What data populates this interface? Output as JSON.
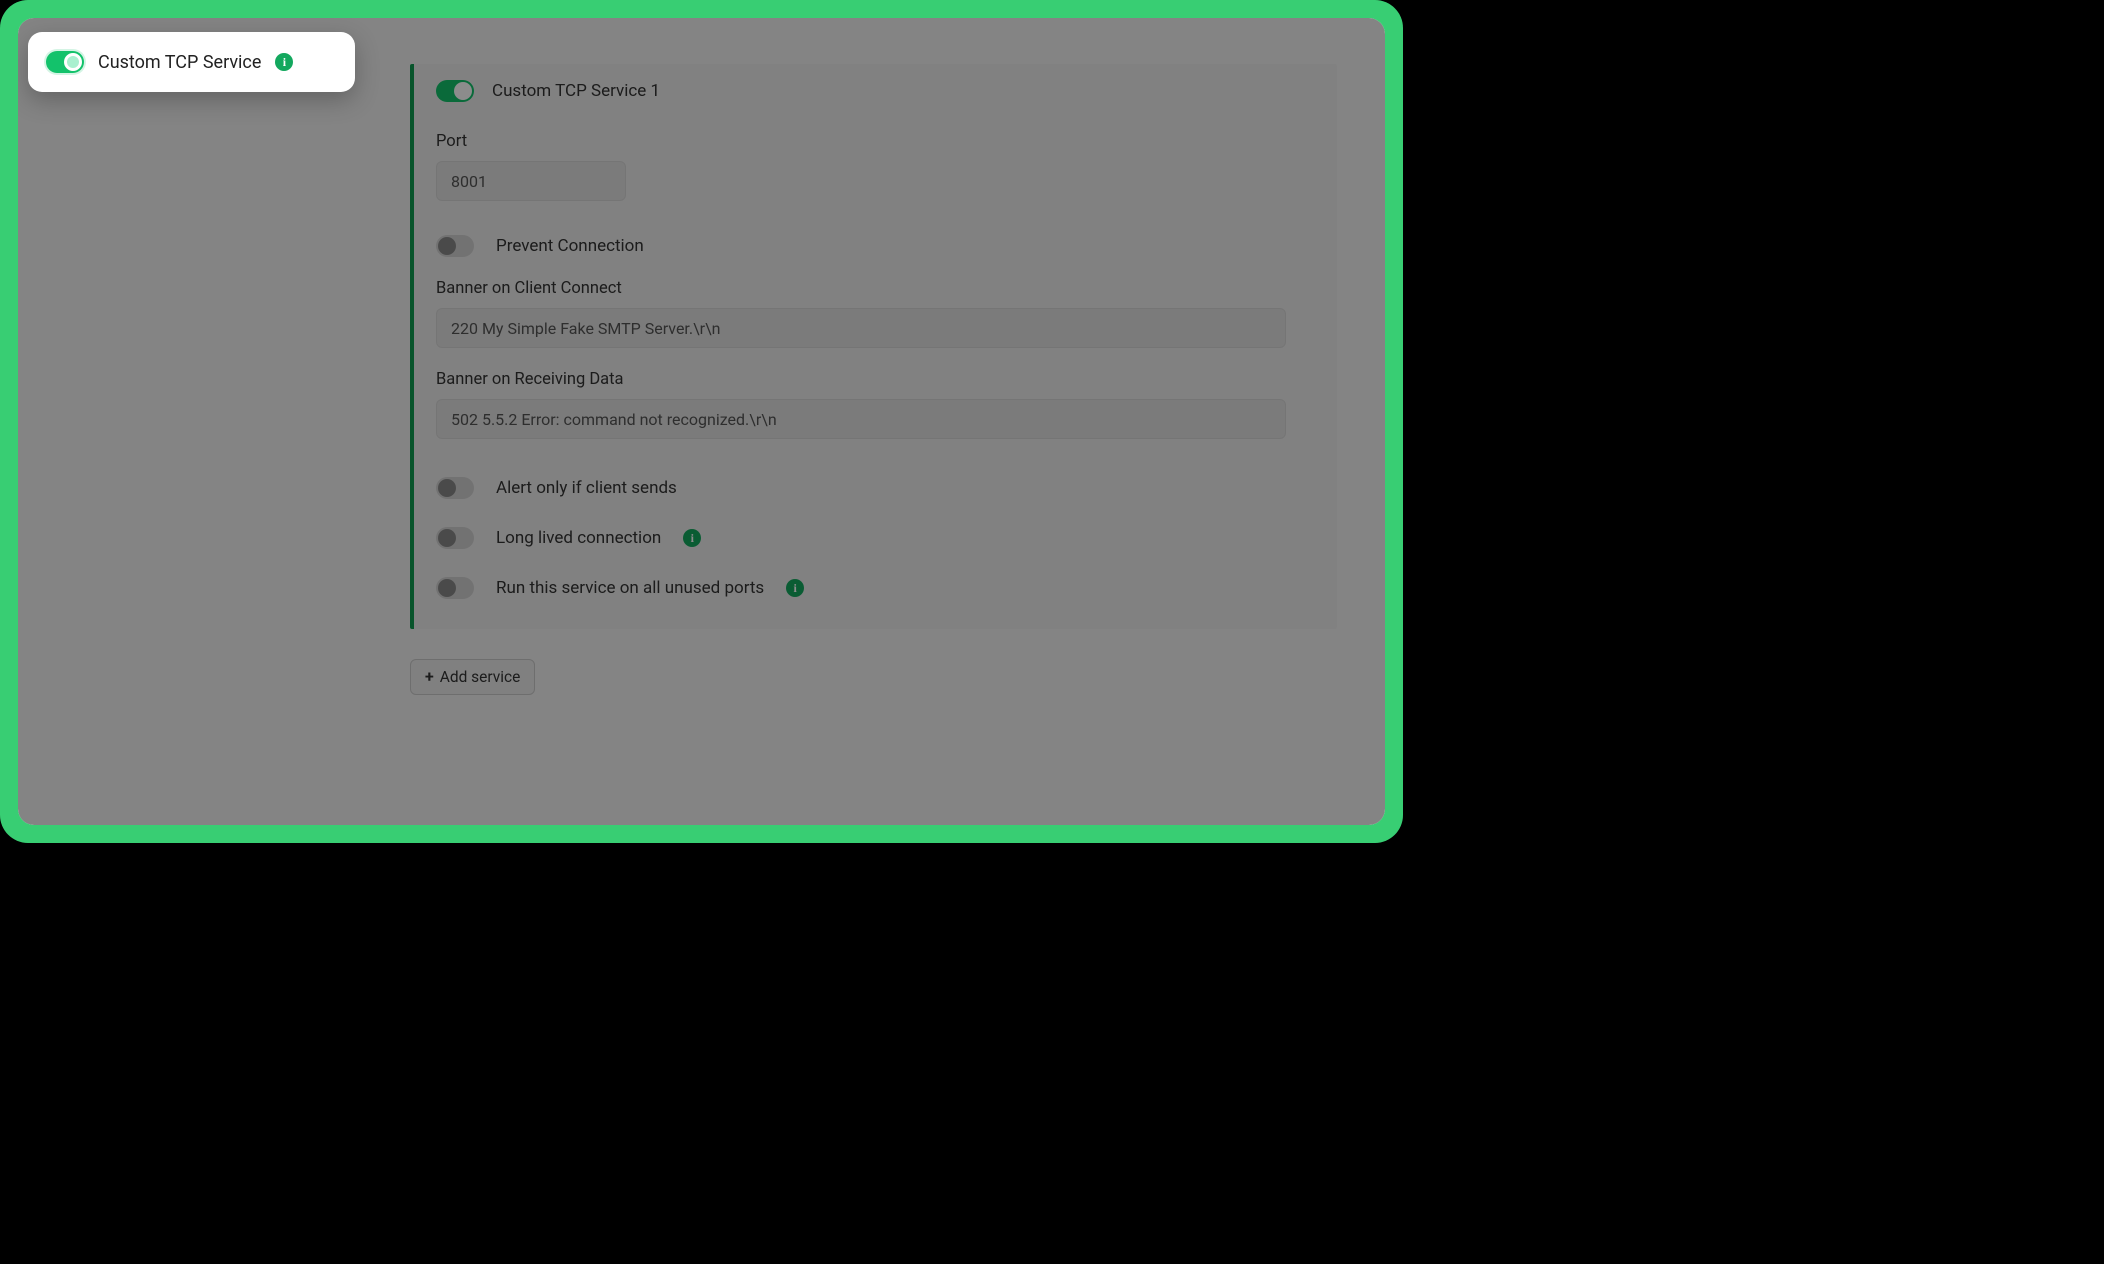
{
  "highlight": {
    "label": "Custom TCP Service",
    "enabled": true
  },
  "service": {
    "header_label": "Custom TCP Service 1",
    "header_enabled": true,
    "port": {
      "label": "Port",
      "value": "8001"
    },
    "prevent_connection": {
      "label": "Prevent Connection",
      "enabled": false
    },
    "banner_connect": {
      "label": "Banner on Client Connect",
      "value": "220 My Simple Fake SMTP Server.\\r\\n"
    },
    "banner_receive": {
      "label": "Banner on Receiving Data",
      "value": "502 5.5.2 Error: command not recognized.\\r\\n"
    },
    "alert_only_if_sends": {
      "label": "Alert only if client sends",
      "enabled": false
    },
    "long_lived": {
      "label": "Long lived connection",
      "enabled": false
    },
    "run_all_unused": {
      "label": "Run this service on all unused ports",
      "enabled": false
    }
  },
  "add_button": {
    "label": "Add service"
  }
}
